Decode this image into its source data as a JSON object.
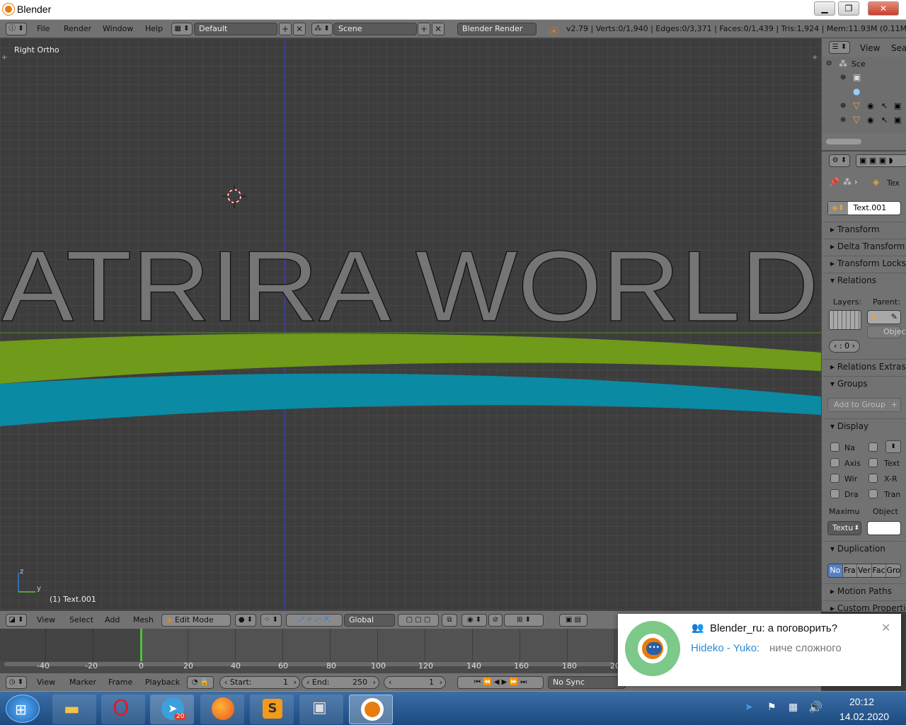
{
  "window": {
    "title": "Blender"
  },
  "info_header": {
    "menus": [
      "File",
      "Render",
      "Window",
      "Help"
    ],
    "screen_layout": "Default",
    "scene": "Scene",
    "render_engine": "Blender Render",
    "stats": "v2.79 | Verts:0/1,940 | Edges:0/3,371 | Faces:0/1,439 | Tris:1,924 | Mem:11.93M (0.11M) | Tex"
  },
  "viewport": {
    "view_label": "Right Ortho",
    "object_label": "(1) Text.001",
    "scene_text": "ATRIRA WORLD",
    "axis_z": "z",
    "axis_y": "y",
    "colors": {
      "green_band": "#6f9a1a",
      "blue_band": "#0b8aa3",
      "grid": "#3d3d3d"
    }
  },
  "outliner": {
    "header_label": "View",
    "header_label2": "Sear",
    "scene_item": "Sce"
  },
  "properties": {
    "breadcrumb": "Tex",
    "object_name": "Text.001",
    "panels": {
      "transform": "Transform",
      "delta_transform": "Delta Transform",
      "transform_locks": "Transform Locks",
      "relations": "Relations",
      "layers_label": "Layers:",
      "parent_label": "Parent:",
      "parent_type": "Objec",
      "pass_index": "0",
      "relations_extras": "Relations Extras",
      "groups": "Groups",
      "add_to_group": "Add to Group",
      "display": "Display",
      "display_checks": [
        {
          "label": "Na"
        },
        {
          "label": "Axis"
        },
        {
          "label": "Text"
        },
        {
          "label": "Wir"
        },
        {
          "label": "X-R"
        },
        {
          "label": "Dra"
        },
        {
          "label": "Tran"
        }
      ],
      "maximum_label": "Maximu",
      "object_label": "Object",
      "maximum_value": "Textu",
      "duplication": "Duplication",
      "dup_options": [
        "No",
        "Fra",
        "Ver",
        "Fac",
        "Gro"
      ],
      "motion_paths": "Motion Paths",
      "custom_properties": "Custom Properti"
    }
  },
  "view3d_header": {
    "menus": [
      "View",
      "Select",
      "Add",
      "Mesh"
    ],
    "mode": "Edit Mode",
    "orientation": "Global"
  },
  "timeline": {
    "ticks": [
      "-40",
      "-20",
      "0",
      "20",
      "40",
      "60",
      "80",
      "100",
      "120",
      "140",
      "160",
      "180",
      "20"
    ],
    "menus": [
      "View",
      "Marker",
      "Frame",
      "Playback"
    ],
    "start": "Start:",
    "start_value": "1",
    "end": "End:",
    "end_value": "250",
    "current_frame": "1",
    "sync": "No Sync",
    "current_frame_pos": 0
  },
  "notification": {
    "title": "Blender_ru: а поговорить?",
    "sender": "Hideko - Yuko:",
    "message": "ниче сложного"
  },
  "taskbar": {
    "time": "20:12",
    "date": "14.02.2020",
    "telegram_badge": "20"
  }
}
